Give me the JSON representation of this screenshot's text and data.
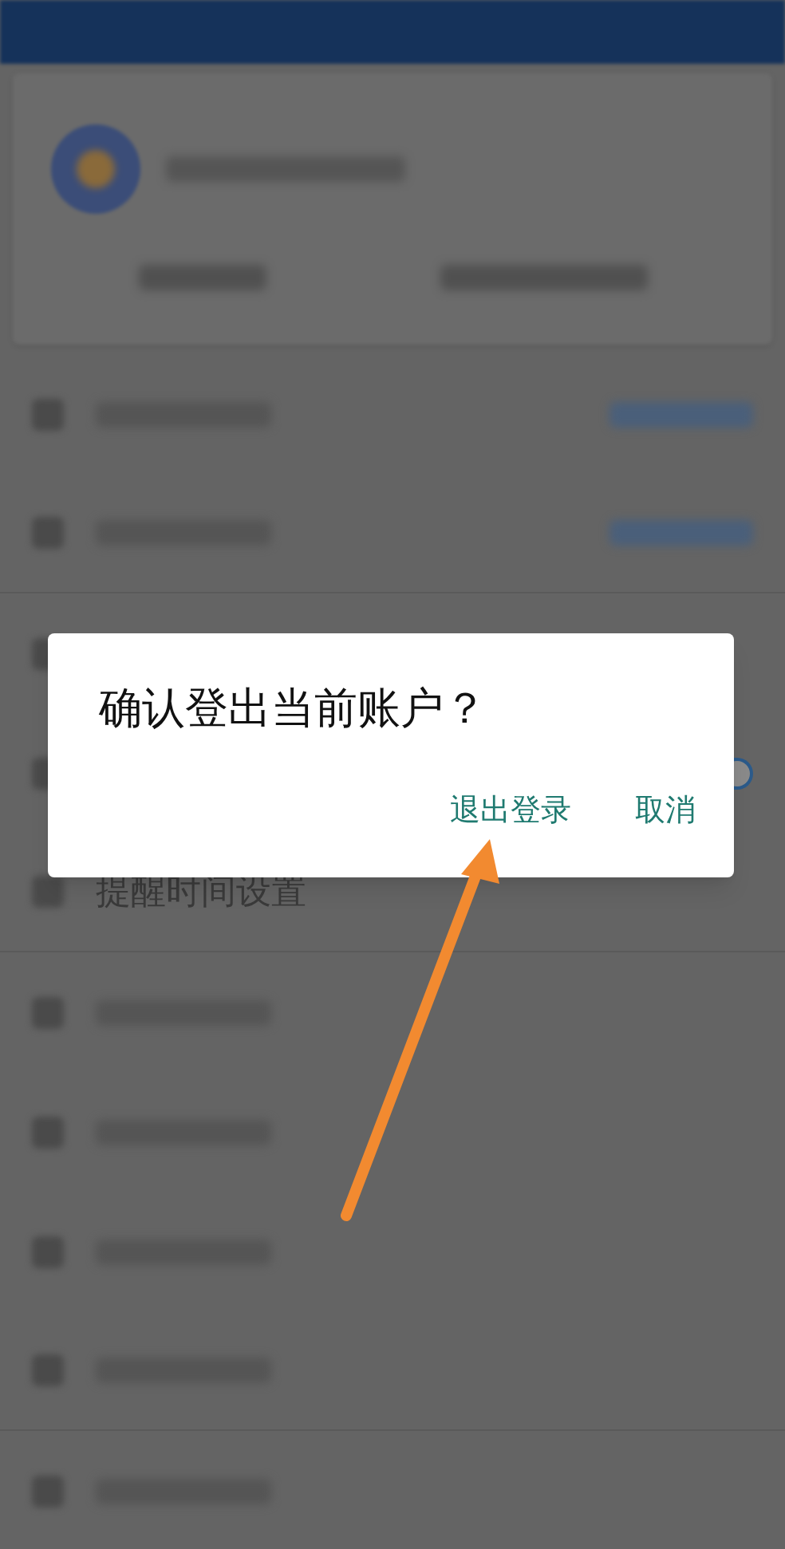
{
  "rows": [
    {
      "kind": "link"
    },
    {
      "kind": "link"
    },
    {
      "kind": "covered"
    },
    {
      "kind": "toggle",
      "on": true
    },
    {
      "kind": "labelled",
      "label": "提醒时间设置"
    },
    {
      "kind": "plain"
    },
    {
      "kind": "plain"
    },
    {
      "kind": "plain"
    },
    {
      "kind": "plain"
    },
    {
      "kind": "plain"
    }
  ],
  "dialog": {
    "title": "确认登出当前账户？",
    "buttons": [
      "退出登录",
      "取消"
    ]
  }
}
